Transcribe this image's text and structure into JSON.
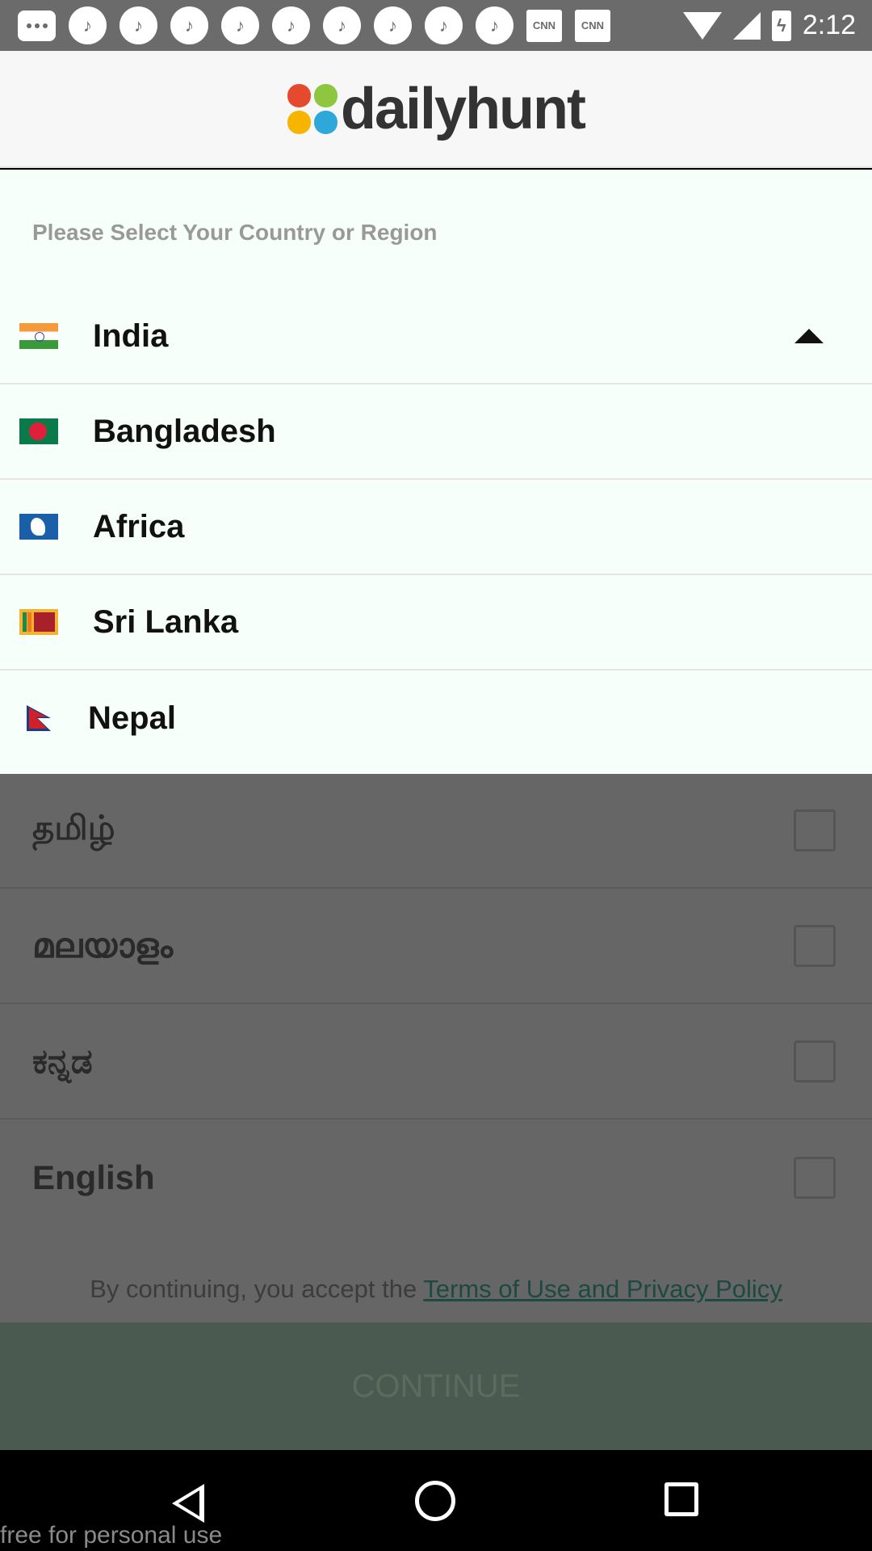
{
  "status_bar": {
    "time": "2:12",
    "notification_icons": [
      "message-icon",
      "music-app-icon",
      "music-app-icon",
      "music-app-icon",
      "music-app-icon",
      "music-app-icon",
      "music-app-icon",
      "music-app-icon",
      "music-app-icon",
      "music-app-icon",
      "cnn-icon",
      "cnn-icon"
    ],
    "cnn_label": "CNN"
  },
  "header": {
    "logo_text": "dailyhunt",
    "logo_colors": [
      "#e64a2e",
      "#8dc63f",
      "#f7b500",
      "#2ea8d8"
    ]
  },
  "region": {
    "title": "Please Select Your Country or Region",
    "selected": "India",
    "countries": [
      {
        "name": "India",
        "flag": "india-flag-icon"
      },
      {
        "name": "Bangladesh",
        "flag": "bangladesh-flag-icon"
      },
      {
        "name": "Africa",
        "flag": "africa-flag-icon"
      },
      {
        "name": "Sri Lanka",
        "flag": "sri-lanka-flag-icon"
      },
      {
        "name": "Nepal",
        "flag": "nepal-flag-icon"
      }
    ]
  },
  "languages": [
    {
      "label": "தமிழ்"
    },
    {
      "label": "മലയാളം"
    },
    {
      "label": "ಕನ್ನಡ"
    },
    {
      "label": "English"
    }
  ],
  "terms": {
    "prefix": "By continuing, you accept the ",
    "link": "Terms of Use and Privacy Policy "
  },
  "continue_label": "CONTINUE",
  "watermark": "free for personal use"
}
